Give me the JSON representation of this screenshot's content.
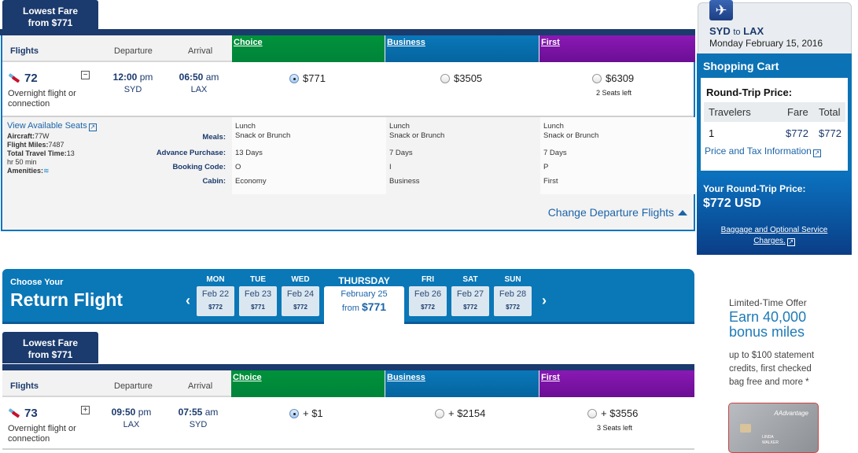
{
  "departure": {
    "lowest_fare_tab": {
      "line1": "Lowest Fare",
      "line2": "from $771"
    },
    "headers": {
      "flights": "Flights",
      "departure": "Departure",
      "arrival": "Arrival"
    },
    "fare_classes": [
      {
        "label": "Choice",
        "color": "#00923a"
      },
      {
        "label": "Business",
        "color": "#0a78b9"
      },
      {
        "label": "First",
        "color": "#8a19b4"
      }
    ],
    "flight": {
      "number": "72",
      "note_line1": "Overnight flight or",
      "note_line2": "connection",
      "toggle": "−",
      "dep_time": "12:00",
      "dep_ampm": "pm",
      "dep_code": "SYD",
      "arr_time": "06:50",
      "arr_ampm": "am",
      "arr_code": "LAX",
      "fares": [
        {
          "price": "$771",
          "selected": true,
          "seats": ""
        },
        {
          "price": "$3505",
          "selected": false,
          "seats": ""
        },
        {
          "price": "$6309",
          "selected": false,
          "seats": "2 Seats left"
        }
      ]
    },
    "details": {
      "view_seats": "View Available Seats",
      "aircraft_label": "Aircraft:",
      "aircraft": "77W",
      "miles_label": "Flight Miles:",
      "miles": "7487",
      "travel_time_label": "Total Travel Time:",
      "travel_time_1": "13",
      "travel_time_2": "hr 50 min",
      "amenities_label": "Amenities:",
      "labels": {
        "meals": "Meals:",
        "advance": "Advance Purchase:",
        "booking": "Booking Code:",
        "cabin": "Cabin:"
      },
      "columns": [
        {
          "meal1": "Lunch",
          "meal2": "Snack or Brunch",
          "advance": "13 Days",
          "booking": "O",
          "cabin": "Economy"
        },
        {
          "meal1": "Lunch",
          "meal2": "Snack or Brunch",
          "advance": "7 Days",
          "booking": "I",
          "cabin": "Business"
        },
        {
          "meal1": "Lunch",
          "meal2": "Snack or Brunch",
          "advance": "7 Days",
          "booking": "P",
          "cabin": "First"
        }
      ]
    },
    "change_link": "Change Departure Flights"
  },
  "return_bar": {
    "subtitle": "Choose Your",
    "title": "Return Flight",
    "prev": "‹",
    "next": "›",
    "days": [
      {
        "day": "MON",
        "date": "Feb 22",
        "price": "$772"
      },
      {
        "day": "TUE",
        "date": "Feb 23",
        "price": "$771"
      },
      {
        "day": "WED",
        "date": "Feb 24",
        "price": "$772"
      },
      {
        "day": "FRI",
        "date": "Feb 26",
        "price": "$772"
      },
      {
        "day": "SAT",
        "date": "Feb 27",
        "price": "$772"
      },
      {
        "day": "SUN",
        "date": "Feb 28",
        "price": "$772"
      }
    ],
    "selected": {
      "day": "THURSDAY",
      "date": "February 25",
      "from": "from",
      "price": "$771"
    }
  },
  "return": {
    "lowest_fare_tab": {
      "line1": "Lowest Fare",
      "line2": "from $771"
    },
    "headers": {
      "flights": "Flights",
      "departure": "Departure",
      "arrival": "Arrival"
    },
    "fare_classes": [
      {
        "label": "Choice"
      },
      {
        "label": "Business"
      },
      {
        "label": "First"
      }
    ],
    "flight": {
      "number": "73",
      "note_line1": "Overnight flight or",
      "note_line2": "connection",
      "toggle": "+",
      "dep_time": "09:50",
      "dep_ampm": "pm",
      "dep_code": "LAX",
      "arr_time": "07:55",
      "arr_ampm": "am",
      "arr_code": "SYD",
      "fares": [
        {
          "price": "+ $1",
          "selected": true,
          "seats": ""
        },
        {
          "price": "+ $2154",
          "selected": false,
          "seats": ""
        },
        {
          "price": "+ $3556",
          "selected": false,
          "seats": "3 Seats left"
        }
      ]
    }
  },
  "sidebar": {
    "origin": "SYD",
    "to": "to",
    "destination": "LAX",
    "date": "Monday February 15, 2016",
    "cart_title": "Shopping Cart",
    "round_trip_label": "Round-Trip Price:",
    "table_headers": {
      "travelers": "Travelers",
      "fare": "Fare",
      "total": "Total"
    },
    "row": {
      "travelers": "1",
      "fare": "$772",
      "total": "$772"
    },
    "price_tax_link": "Price and Tax Information",
    "your_price_label": "Your Round-Trip Price:",
    "your_price": "$772 USD",
    "baggage_link_1": "Baggage and Optional Service",
    "baggage_link_2": "Charges."
  },
  "ad": {
    "line1": "Limited-Time Offer",
    "headline1": "Earn 40,000",
    "headline2": "bonus miles",
    "body1": "up to $100 statement",
    "body2": "credits, first checked",
    "body3": "bag free and more *",
    "card_brand": "AAdvantage",
    "card_name1": "LINDA",
    "card_name2": "WALKER"
  }
}
